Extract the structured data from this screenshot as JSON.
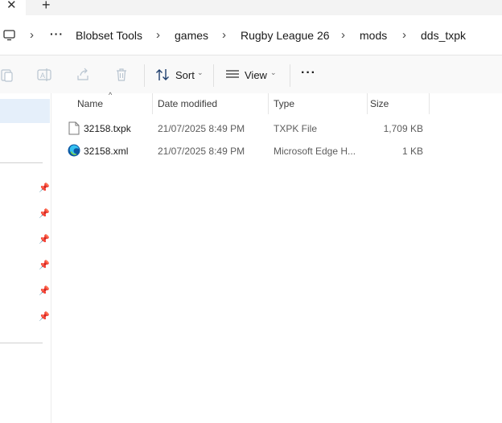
{
  "titlebar": {
    "close_glyph": "✕",
    "new_tab_glyph": "+"
  },
  "breadcrumb": {
    "sep": "›",
    "more": "···",
    "items": [
      "Blobset Tools",
      "games",
      "Rugby League 26",
      "mods",
      "dds_txpk"
    ]
  },
  "toolbar": {
    "sort_label": "Sort",
    "view_label": "View",
    "more_glyph": "···",
    "chevron": "⌄"
  },
  "columns": {
    "name": "Name",
    "date": "Date modified",
    "type": "Type",
    "size": "Size",
    "sort_glyph": "^"
  },
  "files": [
    {
      "name": "32158.txpk",
      "date": "21/07/2025 8:49 PM",
      "type": "TXPK File",
      "size": "1,709 KB",
      "icon": "generic-file-icon"
    },
    {
      "name": "32158.xml",
      "date": "21/07/2025 8:49 PM",
      "type": "Microsoft Edge H...",
      "size": "1 KB",
      "icon": "edge-icon"
    }
  ],
  "sidebar": {
    "pin_glyph": "📌"
  },
  "colors": {
    "accent": "#0067c0",
    "selected_bg": "#e5effa"
  }
}
